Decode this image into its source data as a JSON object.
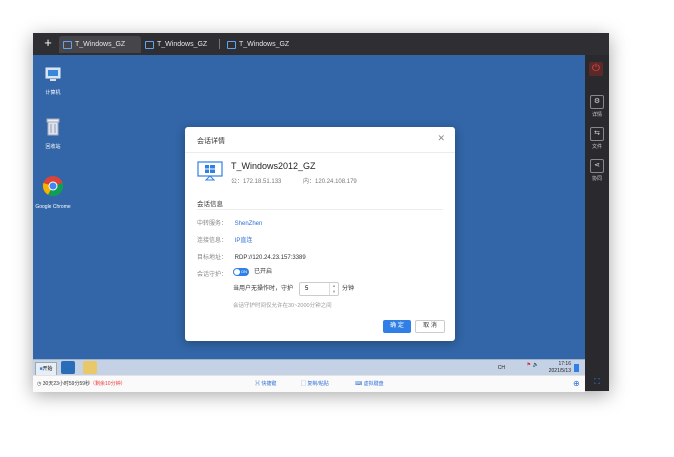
{
  "tabs": [
    {
      "label": "T_Windows_GZ"
    },
    {
      "label": "T_Windows_GZ"
    },
    {
      "label": "T_Windows_GZ"
    }
  ],
  "desktop": {
    "icons": [
      {
        "label": "计算机"
      },
      {
        "label": "回收站"
      },
      {
        "label": "Google Chrome"
      }
    ]
  },
  "sidebar": {
    "items": [
      {
        "label": "详情"
      },
      {
        "label": "文件"
      },
      {
        "label": "协同"
      }
    ]
  },
  "taskbar": {
    "start_label": "开始",
    "ime": "CH",
    "time": "17:16",
    "date": "2021/5/13"
  },
  "statusbar": {
    "session_time_prefix": "30天23小时59分59秒",
    "session_time_remaining": "（剩余10分钟）",
    "links": [
      "快捷键",
      "复制/粘贴",
      "虚拟键盘"
    ]
  },
  "dialog": {
    "title": "会话详情",
    "host_name": "T_Windows2012_GZ",
    "public_ip": "公：172.18.51.133",
    "private_ip": "内：120.24.108.179",
    "section_title": "会话信息",
    "rows": [
      {
        "key": "中转服务：",
        "value": "ShenZhen"
      },
      {
        "key": "连接信息：",
        "value": "IP直连"
      },
      {
        "key": "目标地址：",
        "value": "RDP://120.24.23.157:3389"
      }
    ],
    "guard_key": "会话守护：",
    "toggle_text": "ON",
    "toggle_label": "已开启",
    "idle_label": "当用户无操作时，守护",
    "idle_value": "5",
    "idle_unit": "分钟",
    "hint": "会话守护时间仅允许在30~2000分钟之间",
    "confirm_label": "确 定",
    "cancel_label": "取 消"
  }
}
